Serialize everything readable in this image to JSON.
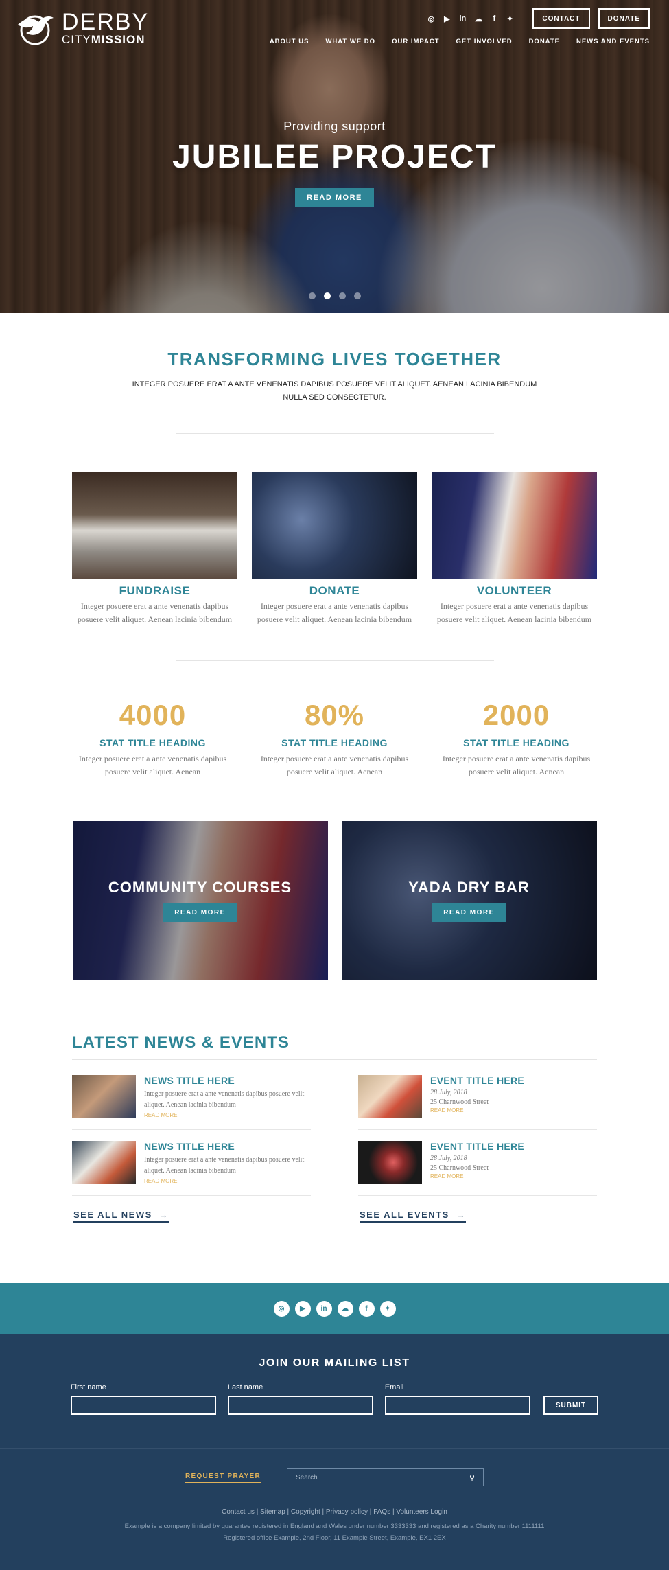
{
  "brand": {
    "line1": "DERBY",
    "line2_light": "CITY",
    "line2_bold": "MISSION"
  },
  "header": {
    "social_icons": [
      "instagram-icon",
      "youtube-icon",
      "linkedin-icon",
      "snapchat-icon",
      "facebook-icon",
      "twitter-icon"
    ],
    "contact_label": "CONTACT",
    "donate_label": "DONATE",
    "nav": [
      "ABOUT US",
      "WHAT WE DO",
      "OUR IMPACT",
      "GET INVOLVED",
      "DONATE",
      "NEWS AND EVENTS"
    ]
  },
  "hero": {
    "kicker": "Providing support",
    "title": "JUBILEE PROJECT",
    "button": "READ MORE",
    "slides": 4,
    "active_slide": 2
  },
  "intro": {
    "title": "TRANSFORMING LIVES TOGETHER",
    "text": "INTEGER POSUERE ERAT A ANTE VENENATIS DAPIBUS POSUERE VELIT ALIQUET. AENEAN LACINIA BIBENDUM NULLA SED CONSECTETUR."
  },
  "cards": [
    {
      "title": "FUNDRAISE",
      "text": "Integer posuere erat a ante venenatis dapibus posuere velit aliquet. Aenean lacinia bibendum"
    },
    {
      "title": "DONATE",
      "text": "Integer posuere erat a ante venenatis dapibus posuere velit aliquet. Aenean lacinia bibendum"
    },
    {
      "title": "VOLUNTEER",
      "text": "Integer posuere erat a ante venenatis dapibus posuere velit aliquet. Aenean lacinia bibendum"
    }
  ],
  "stats": [
    {
      "num": "4000",
      "title": "STAT TITLE HEADING",
      "text": "Integer posuere erat a ante venenatis dapibus posuere velit aliquet. Aenean"
    },
    {
      "num": "80%",
      "title": "STAT TITLE HEADING",
      "text": "Integer posuere erat a ante venenatis dapibus posuere velit aliquet. Aenean"
    },
    {
      "num": "2000",
      "title": "STAT TITLE HEADING",
      "text": "Integer posuere erat a ante venenatis dapibus posuere velit aliquet. Aenean"
    }
  ],
  "tiles": [
    {
      "title": "COMMUNITY COURSES",
      "button": "READ MORE"
    },
    {
      "title": "YADA DRY BAR",
      "button": "READ MORE"
    }
  ],
  "news_section": {
    "title": "LATEST NEWS & EVENTS",
    "news": [
      {
        "title": "NEWS TITLE HERE",
        "text": "Integer posuere erat a ante venenatis dapibus posuere velit aliquet. Aenean lacinia bibendum",
        "more": "READ MORE"
      },
      {
        "title": "NEWS TITLE HERE",
        "text": "Integer posuere erat a ante venenatis dapibus posuere velit aliquet. Aenean lacinia bibendum",
        "more": "READ MORE"
      }
    ],
    "events": [
      {
        "title": "EVENT TITLE HERE",
        "date": "28 July, 2018",
        "address": "25 Charnwood Street",
        "more": "READ MORE"
      },
      {
        "title": "EVENT TITLE HERE",
        "date": "28 July, 2018",
        "address": "25 Charnwood Street",
        "more": "READ MORE"
      }
    ],
    "see_all_news": "SEE ALL NEWS",
    "see_all_events": "SEE ALL EVENTS",
    "arrow": "→"
  },
  "social_bar": {
    "icons": [
      "instagram-icon",
      "youtube-icon",
      "linkedin-icon",
      "snapchat-icon",
      "facebook-icon",
      "twitter-icon"
    ]
  },
  "mailing": {
    "title": "JOIN OUR MAILING LIST",
    "first_name_label": "First name",
    "last_name_label": "Last name",
    "email_label": "Email",
    "submit": "SUBMIT"
  },
  "footer": {
    "request_prayer": "REQUEST PRAYER",
    "search_placeholder": "Search",
    "links": [
      "Contact us",
      "Sitemap",
      "Copyright",
      "Privacy policy",
      "FAQs",
      "Volunteers Login"
    ],
    "separator": " | ",
    "company_line": "Example is a company limited by guarantee registered in England and Wales under number 3333333 and registered as a Charity number 1111111",
    "office_line": "Registered office Example, 2nd Floor, 11 Example Street, Example, EX1 2EX"
  },
  "colors": {
    "teal": "#2e8596",
    "navy": "#23405e",
    "gold": "#e1b35a"
  }
}
